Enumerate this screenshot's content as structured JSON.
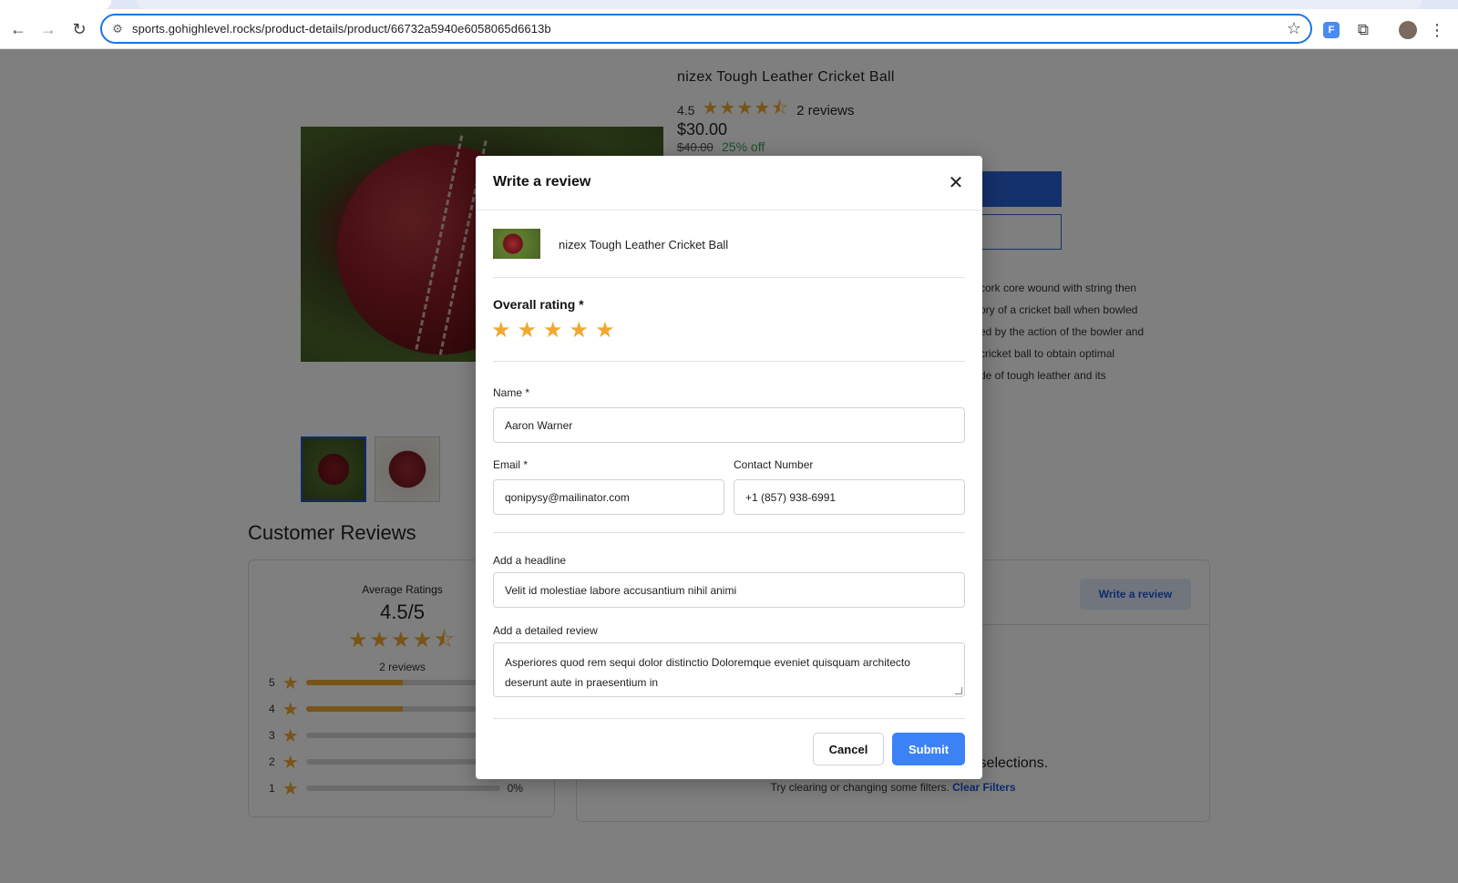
{
  "browser": {
    "url": "sports.gohighlevel.rocks/product-details/product/66732a5940e6058065d6613b",
    "icons": {
      "back": "←",
      "forward": "→",
      "reload": "↻",
      "site_info": "⚙",
      "bookmark": "☆",
      "translate": "F",
      "extensions": "⧉",
      "menu": "⋮"
    }
  },
  "product": {
    "title": "nizex Tough Leather Cricket Ball",
    "rating": "4.5",
    "stars": "★★★★⯪",
    "reviews_count": "2 reviews",
    "price": "$30.00",
    "old_price": "$40.00",
    "discount": "25% off",
    "description_lines": [
      "cork core wound with string then",
      "ory of a cricket ball when bowled",
      "ed by the action of the bowler and",
      " cricket ball to obtain optimal",
      "de of tough leather and its"
    ]
  },
  "customer_reviews": {
    "heading": "Customer Reviews",
    "average_label": "Average Ratings",
    "average_score": "4.5/5",
    "average_stars": "★★★★⯪",
    "count": "2 reviews",
    "breakdown": [
      {
        "stars": "5",
        "fill": 0.5,
        "pct": ""
      },
      {
        "stars": "4",
        "fill": 0.5,
        "pct": ""
      },
      {
        "stars": "3",
        "fill": 0,
        "pct": ""
      },
      {
        "stars": "2",
        "fill": 0,
        "pct": "0%"
      },
      {
        "stars": "1",
        "fill": 0,
        "pct": "0%"
      }
    ],
    "write_review_label": "Write a review",
    "empty_message": "Sorry, no reviews match your current selections.",
    "hint_text": "Try clearing or changing some filters.",
    "clear_filters_label": "Clear Filters"
  },
  "modal": {
    "title": "Write a review",
    "product_name": "nizex Tough Leather Cricket Ball",
    "overall_rating_label": "Overall rating *",
    "rating_stars": [
      "★",
      "★",
      "★",
      "★",
      "★"
    ],
    "name_label": "Name *",
    "name_value": "Aaron Warner",
    "email_label": "Email *",
    "email_value": "qonipysy@mailinator.com",
    "contact_label": "Contact Number",
    "contact_value": "+1 (857) 938-6991",
    "headline_label": "Add a headline",
    "headline_value": "Velit id molestiae labore accusantium nihil animi",
    "review_label": "Add a detailed review",
    "review_value": "Asperiores quod rem sequi dolor distinctio Doloremque eveniet quisquam architecto deserunt aute in praesentium in",
    "cancel_label": "Cancel",
    "submit_label": "Submit"
  },
  "colors": {
    "accent": "#3b82f6",
    "star": "#f0a830",
    "discount": "#3aa05a"
  }
}
